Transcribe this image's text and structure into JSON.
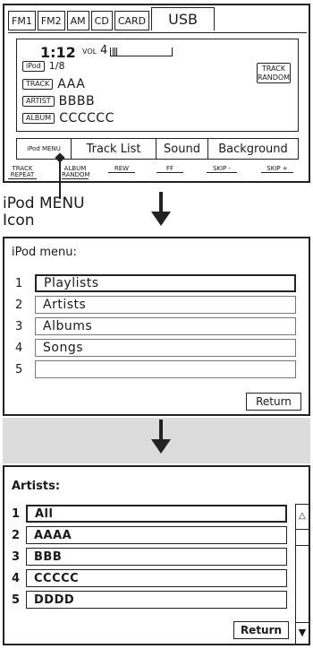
{
  "head_unit": {
    "source_tabs": [
      "FM1",
      "FM2",
      "AM",
      "CD",
      "CARD",
      "USB"
    ],
    "active_tab": "USB",
    "time": "1:12",
    "vol_label": "VOL",
    "vol_value": "4",
    "ipod_tag": "iPod",
    "track_count": "1/8",
    "track_tag": "TRACK",
    "track_value": "AAA",
    "artist_tag": "ARTIST",
    "artist_value": "BBBB",
    "album_tag": "ALBUM",
    "album_value": "CCCCCC",
    "track_random_label": "TRACK RANDOM",
    "menu_bar": {
      "ipod_menu": "iPod MENU",
      "track_list": "Track  List",
      "sound": "Sound",
      "background": "Background"
    },
    "hard_buttons": [
      "TRACK REPEAT",
      "ALBUM RANDOM",
      "REW",
      "FF",
      "SKIP -",
      "SKIP +"
    ]
  },
  "callout": {
    "line1": "iPod MENU",
    "line2": "Icon"
  },
  "ipod_menu": {
    "title": "iPod menu:",
    "items": [
      {
        "num": "1",
        "label": "Playlists"
      },
      {
        "num": "2",
        "label": "Artists"
      },
      {
        "num": "3",
        "label": "Albums"
      },
      {
        "num": "4",
        "label": "Songs"
      },
      {
        "num": "5",
        "label": ""
      }
    ],
    "return_label": "Return"
  },
  "artists": {
    "title": "Artists:",
    "items": [
      {
        "num": "1",
        "label": "All"
      },
      {
        "num": "2",
        "label": "AAAA"
      },
      {
        "num": "3",
        "label": "BBB"
      },
      {
        "num": "4",
        "label": "CCCCC"
      },
      {
        "num": "5",
        "label": "DDDD"
      }
    ],
    "return_label": "Return",
    "scroll_up": "△",
    "scroll_down": "▼"
  },
  "icons": [
    "arrow-down-icon",
    "callout-pointer-icon"
  ],
  "colors": {
    "band_gray": "#dcdcdc",
    "ink": "#1a1a1a"
  }
}
